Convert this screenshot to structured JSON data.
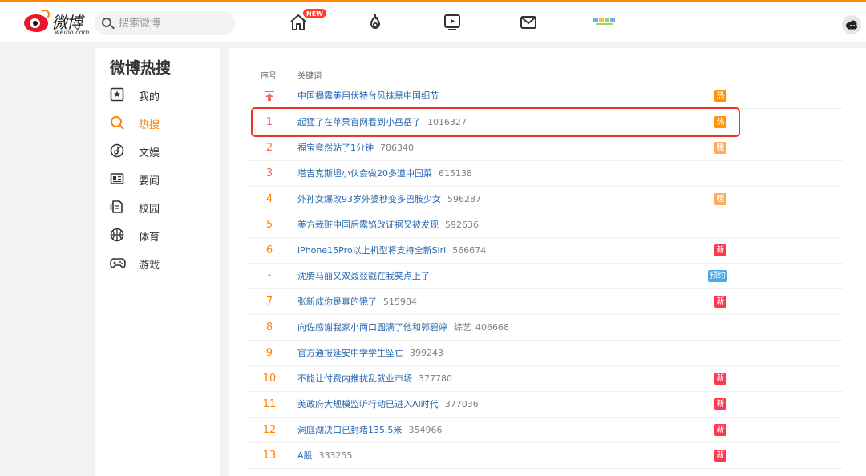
{
  "header": {
    "logo_cn": "微博",
    "logo_en": "weibo.com",
    "search_placeholder": "搜索微博",
    "new_badge": "NEW"
  },
  "sidebar": {
    "title": "微博热搜",
    "items": [
      {
        "label": "我的",
        "icon": "person-card-icon",
        "active": false
      },
      {
        "label": "热搜",
        "icon": "hot-search-icon",
        "active": true
      },
      {
        "label": "文娱",
        "icon": "music-note-icon",
        "active": false
      },
      {
        "label": "要闻",
        "icon": "news-icon",
        "active": false
      },
      {
        "label": "校园",
        "icon": "campus-icon",
        "active": false
      },
      {
        "label": "体育",
        "icon": "basketball-icon",
        "active": false
      },
      {
        "label": "游戏",
        "icon": "gamepad-icon",
        "active": false
      }
    ]
  },
  "table": {
    "col_rank": "序号",
    "col_keyword": "关键词",
    "rows": [
      {
        "rank": "",
        "rank_icon": "pin-top-icon",
        "keyword": "中国揭露美用伏特台风抹黑中国细节",
        "count": "",
        "category": "",
        "tag": "热",
        "tag_color": "#ff9406"
      },
      {
        "rank": "1",
        "keyword": "起猛了在苹果官网看到小岳岳了",
        "count": "1016327",
        "category": "",
        "tag": "热",
        "tag_color": "#ff9406"
      },
      {
        "rank": "2",
        "keyword": "福宝竟然站了1分钟",
        "count": "786340",
        "category": "",
        "tag": "暖",
        "tag_color": "#ffab5a"
      },
      {
        "rank": "3",
        "keyword": "塔吉克斯坦小伙会做20多道中国菜",
        "count": "615138",
        "category": "",
        "tag": "",
        "tag_color": ""
      },
      {
        "rank": "4",
        "keyword": "外孙女爆改93岁外婆秒变多巴胺少女",
        "count": "596287",
        "category": "",
        "tag": "暖",
        "tag_color": "#ffab5a"
      },
      {
        "rank": "5",
        "keyword": "美方栽赃中国后露馅改证据又被发现",
        "count": "592636",
        "category": "",
        "tag": "",
        "tag_color": ""
      },
      {
        "rank": "6",
        "keyword": "iPhone15Pro以上机型将支持全新Siri",
        "count": "566674",
        "category": "",
        "tag": "新",
        "tag_color": "#ff3852"
      },
      {
        "rank": "•",
        "keyword": "沈腾马丽又双叒叕戳在我笑点上了",
        "count": "",
        "category": "",
        "tag": "预约",
        "tag_color": "#4aa8e8"
      },
      {
        "rank": "7",
        "keyword": "张新成你是真的饿了",
        "count": "515984",
        "category": "",
        "tag": "新",
        "tag_color": "#ff3852"
      },
      {
        "rank": "8",
        "keyword": "向佐感谢我家小两口圆满了他和郭碧婷",
        "count": "406668",
        "category": "综艺",
        "tag": "",
        "tag_color": ""
      },
      {
        "rank": "9",
        "keyword": "官方通报延安中学学生坠亡",
        "count": "399243",
        "category": "",
        "tag": "",
        "tag_color": ""
      },
      {
        "rank": "10",
        "keyword": "不能让付费内推扰乱就业市场",
        "count": "377780",
        "category": "",
        "tag": "新",
        "tag_color": "#ff3852"
      },
      {
        "rank": "11",
        "keyword": "美政府大规模监听行动已进入AI时代",
        "count": "377036",
        "category": "",
        "tag": "新",
        "tag_color": "#ff3852"
      },
      {
        "rank": "12",
        "keyword": "洞庭湖决口已封堵135.5米",
        "count": "354966",
        "category": "",
        "tag": "新",
        "tag_color": "#ff3852"
      },
      {
        "rank": "13",
        "keyword": "A股",
        "count": "333255",
        "category": "",
        "tag": "新",
        "tag_color": "#ff3852"
      }
    ]
  },
  "colors": {
    "accent": "#ff8200",
    "link": "#2a69b1",
    "highlight_border": "#e8382a"
  }
}
